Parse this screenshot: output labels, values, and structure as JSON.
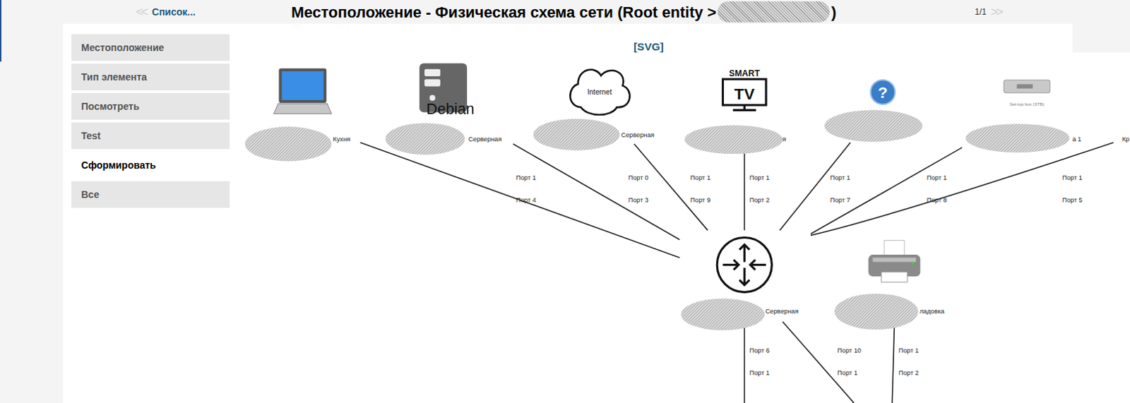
{
  "header": {
    "back_icon": "<<",
    "back": "Список...",
    "title": "Местоположение - Физическая схема сети (Root entity >",
    "title_redacted": true,
    "title_end": ")",
    "page": "1/1",
    "next_icon": ">>",
    "next_disabled": true,
    "back_icon_disabled": true
  },
  "menu": [
    {
      "label": "Местоположение",
      "selected": false
    },
    {
      "label": "Тип элемента",
      "selected": false
    },
    {
      "label": "Посмотреть",
      "selected": false
    },
    {
      "label": "Test",
      "selected": false
    },
    {
      "label": "Сформировать",
      "selected": true
    },
    {
      "label": "Все",
      "selected": false
    }
  ],
  "svg_link": "[SVG]",
  "diagram": {
    "nodes": [
      {
        "kind": "notebook",
        "label": "Кухня",
        "redacted": true
      },
      {
        "kind": "server",
        "icon_text": "Debian",
        "label": "Серверная",
        "redacted": true
      },
      {
        "kind": "cloud",
        "icon_text": "Internet",
        "label": "Серверная",
        "redacted": true
      },
      {
        "kind": "tv",
        "icon_text": "SMART",
        "icon_text2": "TV",
        "label": "ня",
        "redacted": true
      },
      {
        "kind": "unknown",
        "icon_text": "?",
        "redacted": true
      },
      {
        "kind": "stb",
        "icon_text": "Set-top box (STB)",
        "label": "а 1",
        "redacted": true
      },
      {
        "kind": "cut",
        "label": "Кр",
        "redacted": false
      },
      {
        "kind": "router",
        "label": "Серверная",
        "redacted": true
      },
      {
        "kind": "printer",
        "label": "ладовка",
        "redacted": true
      }
    ],
    "edges": [
      {
        "ports": [
          "Порт 1",
          "Порт 4"
        ]
      },
      {
        "ports": [
          "Порт 0",
          "Порт 3"
        ]
      },
      {
        "ports": [
          "Порт 1",
          "Порт 9"
        ]
      },
      {
        "ports": [
          "Порт 1",
          "Порт 2"
        ]
      },
      {
        "ports": [
          "Порт 1",
          "Порт 7"
        ]
      },
      {
        "ports": [
          "Порт 1",
          "Порт 8"
        ]
      },
      {
        "ports": [
          "Порт 1",
          "Порт 5"
        ]
      },
      {
        "ports": [
          "Порт 6",
          "Порт 1"
        ]
      },
      {
        "ports": [
          "Порт 10",
          "Порт 1"
        ]
      },
      {
        "ports": [
          "Порт 1",
          "Порт 2"
        ]
      }
    ]
  }
}
